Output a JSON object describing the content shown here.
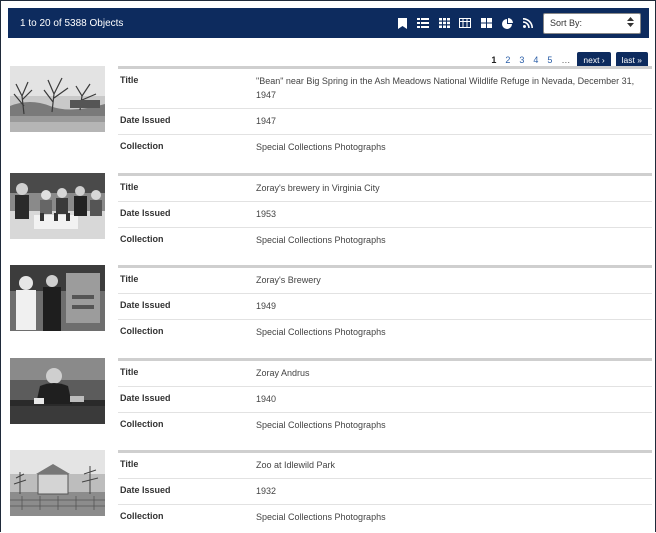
{
  "header": {
    "count_text": "1 to 20 of 5388 Objects",
    "sort_label": "Sort By:",
    "views": [
      "bookmark-icon",
      "list-icon",
      "grid-icon",
      "table-icon",
      "tile-icon",
      "pie-chart-icon",
      "rss-icon"
    ]
  },
  "pagination": {
    "pages": [
      "1",
      "2",
      "3",
      "4",
      "5"
    ],
    "current": "1",
    "ellipsis": "…",
    "next": "next ›",
    "last": "last »"
  },
  "labels": {
    "title": "Title",
    "date": "Date Issued",
    "collection": "Collection"
  },
  "records": [
    {
      "title": "\"Bean\" near Big Spring in the Ash Meadows National Wildlife Refuge in Nevada, December 31, 1947",
      "date": "1947",
      "collection": "Special Collections Photographs"
    },
    {
      "title": "Zoray's brewery in Virginia City",
      "date": "1953",
      "collection": "Special Collections Photographs"
    },
    {
      "title": "Zoray's Brewery",
      "date": "1949",
      "collection": "Special Collections Photographs"
    },
    {
      "title": "Zoray Andrus",
      "date": "1940",
      "collection": "Special Collections Photographs"
    },
    {
      "title": "Zoo at Idlewild Park",
      "date": "1932",
      "collection": "Special Collections Photographs"
    }
  ]
}
